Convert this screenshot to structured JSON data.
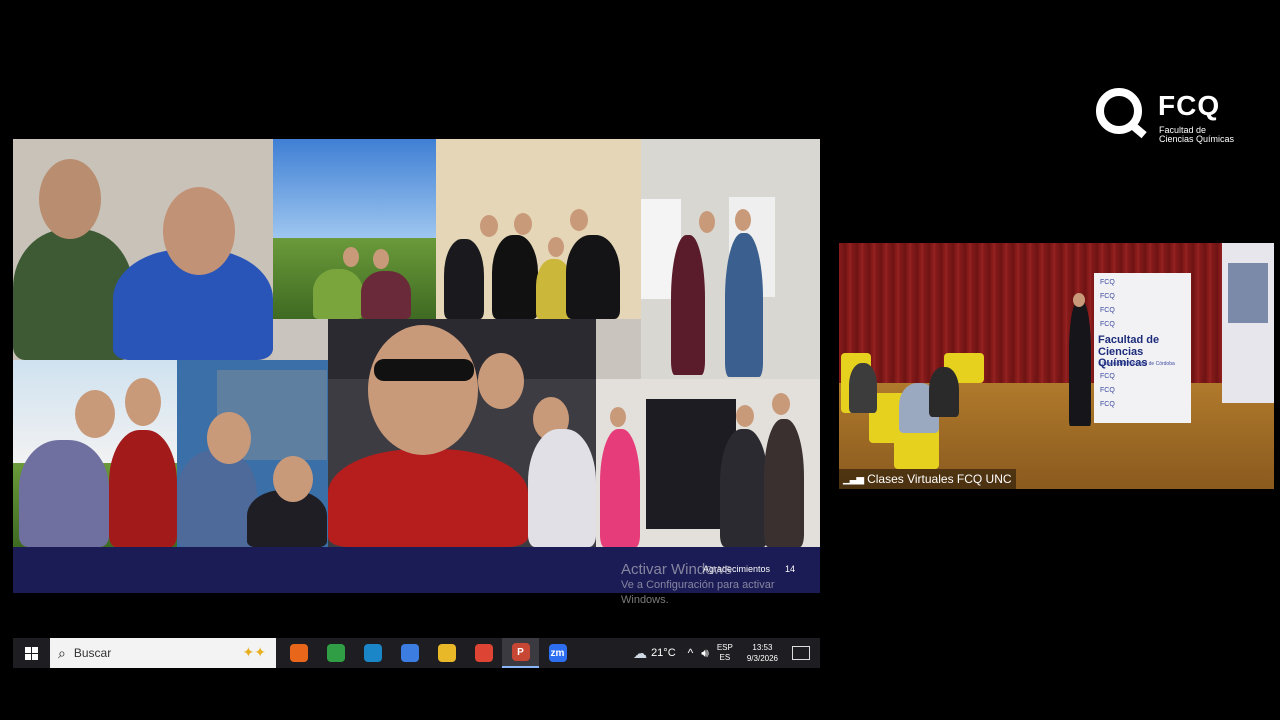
{
  "slide": {
    "footer": {
      "section_label": "Agradecimientos",
      "page_number": "14"
    },
    "watermark": {
      "title": "Activar Windows",
      "line1": "Ve a Configuración para activar",
      "line2": "Windows."
    }
  },
  "taskbar": {
    "search_placeholder": "Buscar",
    "apps": [
      {
        "name": "firefox-icon",
        "glyph": "",
        "color": "#e8661a"
      },
      {
        "name": "chrome-icon",
        "glyph": "",
        "color": "#2f9e44"
      },
      {
        "name": "edge-icon",
        "glyph": "",
        "color": "#1a86c7"
      },
      {
        "name": "store-icon",
        "glyph": "",
        "color": "#3b7de0"
      },
      {
        "name": "file-explorer-icon",
        "glyph": "",
        "color": "#e9b829"
      },
      {
        "name": "chrome-2-icon",
        "glyph": "",
        "color": "#dd4433"
      },
      {
        "name": "powerpoint-icon",
        "glyph": "P",
        "color": "#c74634"
      },
      {
        "name": "zoom-icon",
        "glyph": "zm",
        "color": "#2d6ff0"
      }
    ],
    "weather": {
      "temp": "21°C",
      "icon": "cloud-icon"
    },
    "language": {
      "line1": "ESP",
      "line2": "ES"
    },
    "clock": {
      "time": "13:53",
      "date": "9/3/2026"
    }
  },
  "logo": {
    "brand": "FCQ",
    "subtitle_line1": "Facultad de",
    "subtitle_line2": "Ciencias Químicas"
  },
  "video": {
    "participant_label": "Clases Virtuales FCQ UNC",
    "banner": {
      "title_line1": "Facultad de",
      "title_line2": "Ciencias Químicas",
      "subtitle": "Universidad Nacional de Córdoba",
      "repeat_text": "FCQ"
    }
  }
}
